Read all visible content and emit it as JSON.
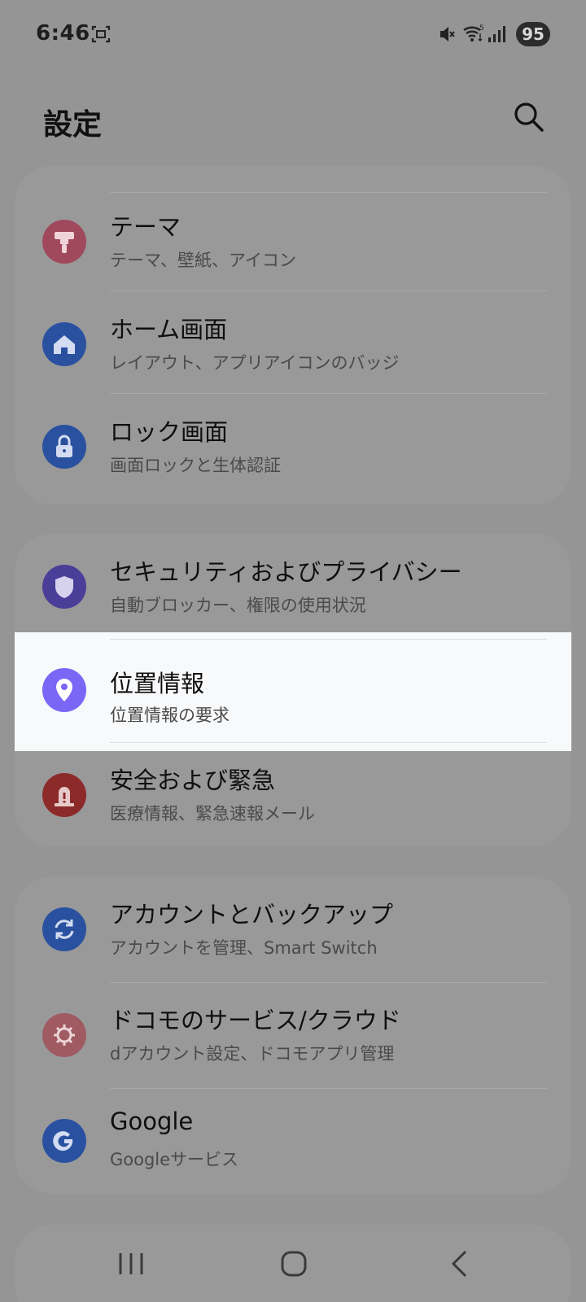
{
  "status_bar": {
    "time": "6:46",
    "battery": "95",
    "icons": [
      "screenshot-icon",
      "mute-icon",
      "wifi-icon",
      "signal-icon"
    ]
  },
  "header": {
    "title": "設定",
    "search_icon": "search-icon"
  },
  "groups": [
    {
      "items": [
        {
          "title": "テーマ",
          "subtitle": "テーマ、壁紙、アイコン",
          "icon": "paint-roller-icon",
          "color": "#a0485c"
        },
        {
          "title": "ホーム画面",
          "subtitle": "レイアウト、アプリアイコンのバッジ",
          "icon": "home-icon",
          "color": "#2a51a0"
        },
        {
          "title": "ロック画面",
          "subtitle": "画面ロックと生体認証",
          "icon": "lock-icon",
          "color": "#2a51a0"
        }
      ]
    },
    {
      "items": [
        {
          "title": "セキュリティおよびプライバシー",
          "subtitle": "自動ブロッカー、権限の使用状況",
          "icon": "shield-icon",
          "color": "#4a3e98"
        },
        {
          "title": "位置情報",
          "subtitle": "位置情報の要求",
          "icon": "location-pin-icon",
          "color": "#7b66f6"
        },
        {
          "title": "安全および緊急",
          "subtitle": "医療情報、緊急速報メール",
          "icon": "warning-icon",
          "color": "#8c2a2a"
        }
      ]
    },
    {
      "items": [
        {
          "title": "アカウントとバックアップ",
          "subtitle": "アカウントを管理、Smart Switch",
          "icon": "sync-icon",
          "color": "#2a51a0"
        },
        {
          "title": "ドコモのサービス/クラウド",
          "subtitle": "dアカウント設定、ドコモアプリ管理",
          "icon": "gear-icon",
          "color": "#9f5a62"
        },
        {
          "title": "Google",
          "subtitle": "Googleサービス",
          "icon": "google-icon",
          "color": "#2a51a0"
        }
      ]
    }
  ],
  "nav": {
    "recent_icon": "recent-apps-icon",
    "home_icon": "home-nav-icon",
    "back_icon": "back-icon"
  }
}
